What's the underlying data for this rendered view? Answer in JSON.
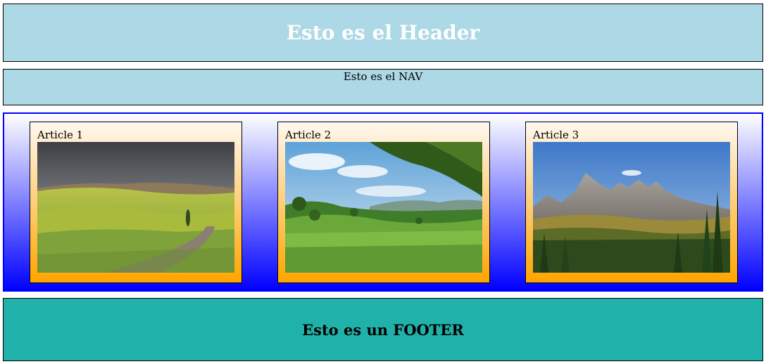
{
  "header": {
    "title": "Esto es el Header"
  },
  "nav": {
    "label": "Esto es el NAV"
  },
  "articles": [
    {
      "label": "Article 1",
      "image": "rolling-hills-landscape-photo"
    },
    {
      "label": "Article 2",
      "image": "green-meadow-landscape-photo"
    },
    {
      "label": "Article 3",
      "image": "mountain-forest-landscape-photo"
    }
  ],
  "footer": {
    "title": "Esto es un FOOTER"
  },
  "colors": {
    "header_bg": "#add8e6",
    "nav_bg": "#add8e6",
    "main_border": "#0000ff",
    "main_gradient_end": "#0000ff",
    "article_gradient_end": "#ffa500",
    "footer_bg": "#20b2aa"
  }
}
